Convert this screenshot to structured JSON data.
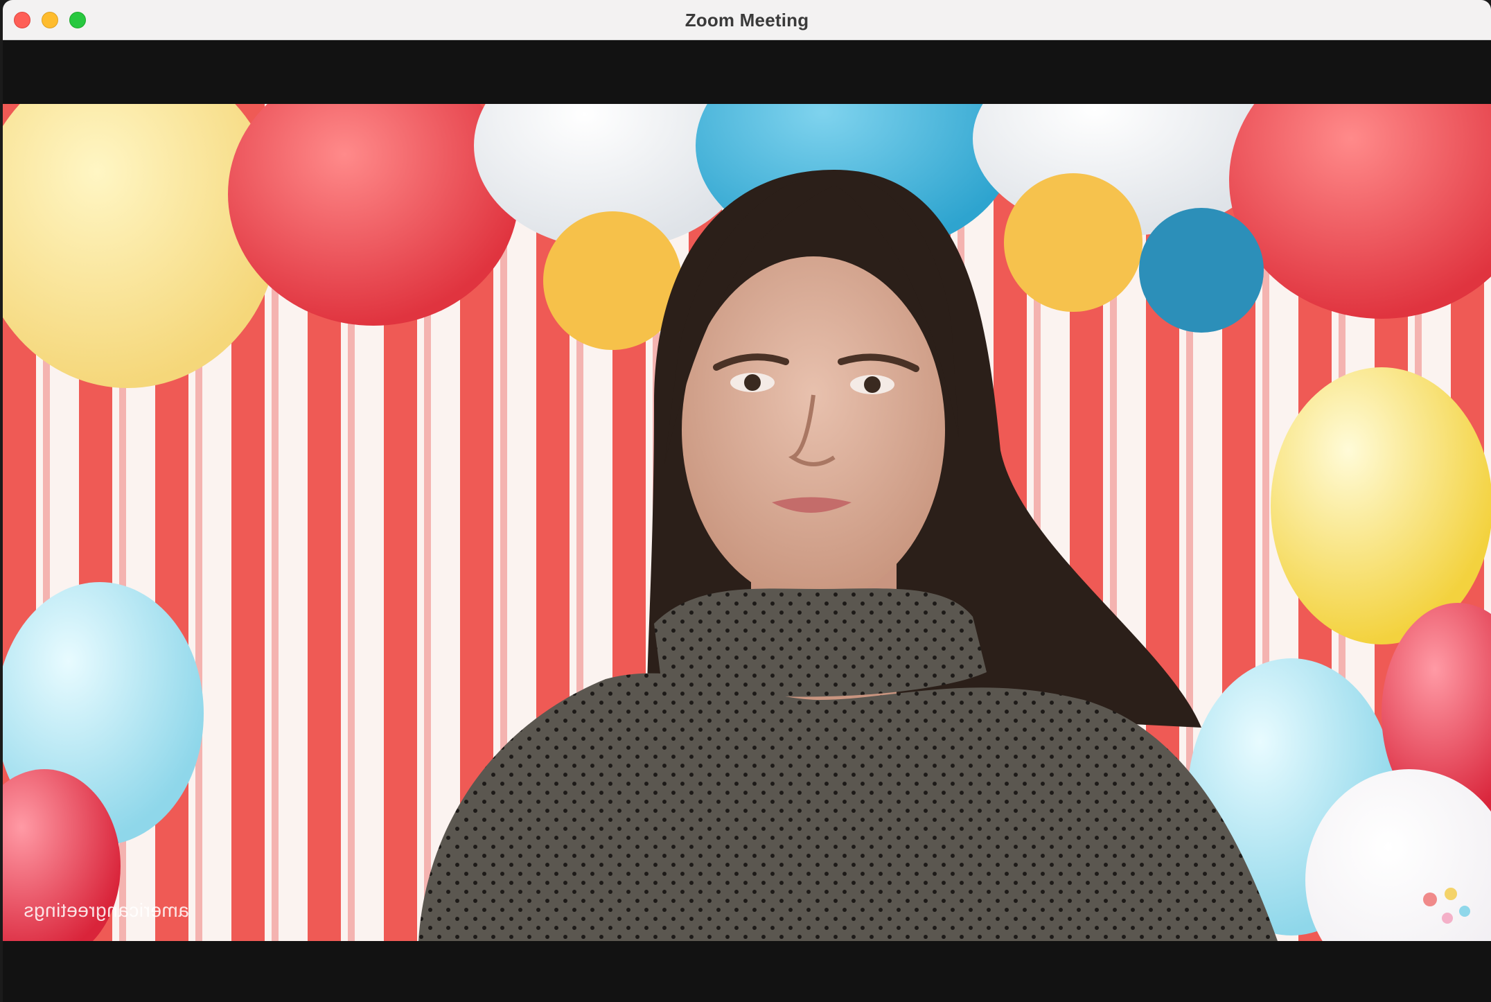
{
  "window": {
    "title": "Zoom Meeting",
    "controls": [
      "close",
      "minimize",
      "zoom"
    ],
    "control_colors": {
      "close": "#fe5f57",
      "minimize": "#febc2e",
      "zoom": "#28c840"
    }
  },
  "video": {
    "background": "party-backdrop-with-pompoms-streamers-balloons",
    "watermark": "americangreetings",
    "participant": "woman-in-polka-dot-turtleneck"
  },
  "colors": {
    "letterbox": "#121212",
    "titlebar": "#f3f2f2"
  }
}
